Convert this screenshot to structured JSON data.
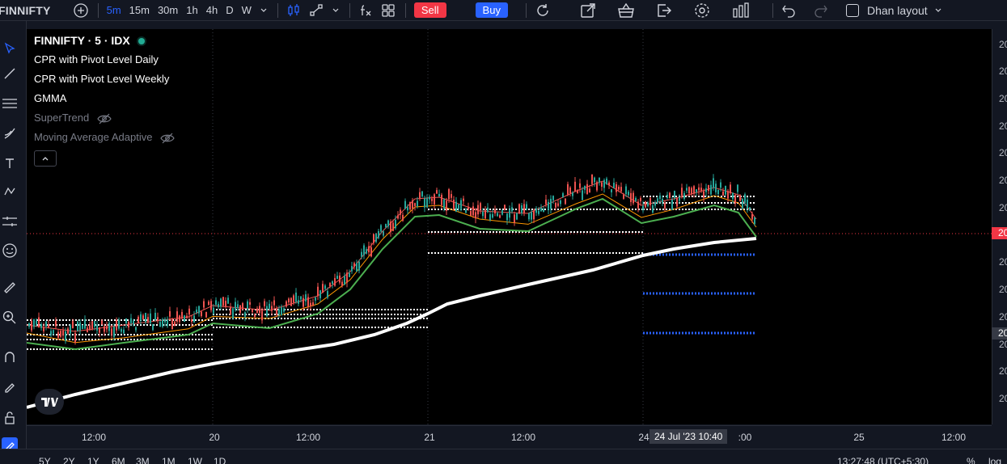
{
  "topbar": {
    "symbol": "FINNIFTY",
    "intervals": [
      "5m",
      "15m",
      "30m",
      "1h",
      "4h",
      "D",
      "W"
    ],
    "active_interval": "5m",
    "sell_label": "Sell",
    "buy_label": "Buy",
    "layout_label": "Dhan layout"
  },
  "legend": {
    "title": "FINNIFTY · 5 · IDX",
    "indicators": [
      {
        "label": "CPR with Pivot Level Daily",
        "hidden": false
      },
      {
        "label": "CPR with Pivot Level Weekly",
        "hidden": false
      },
      {
        "label": "GMMA",
        "hidden": false
      },
      {
        "label": "SuperTrend",
        "hidden": true
      },
      {
        "label": "Moving Average Adaptive",
        "hidden": true
      }
    ]
  },
  "right_axis": {
    "labels": [
      "20",
      "20",
      "20",
      "20",
      "20",
      "20",
      "20",
      "20",
      "20",
      "20",
      "20",
      "20",
      "20",
      "20"
    ],
    "price_badge": "20",
    "cross_badge": "20"
  },
  "time_axis": {
    "labels": [
      {
        "text": "12:00",
        "pos": 0.07
      },
      {
        "text": "20",
        "pos": 0.194
      },
      {
        "text": "12:00",
        "pos": 0.292
      },
      {
        "text": "21",
        "pos": 0.417
      },
      {
        "text": "12:00",
        "pos": 0.514
      },
      {
        "text": "24",
        "pos": 0.64
      },
      {
        "text": ":00",
        "pos": 0.744
      },
      {
        "text": "25",
        "pos": 0.863
      },
      {
        "text": "12:00",
        "pos": 0.962
      }
    ],
    "crosshair_label": "24 Jul '23   10:40"
  },
  "bottombar": {
    "ranges": [
      "5Y",
      "2Y",
      "1Y",
      "6M",
      "3M",
      "1M",
      "1W",
      "1D"
    ],
    "clock": "13:27:48 (UTC+5:30)",
    "percent": "%",
    "log": "log"
  },
  "colors": {
    "up": "#26a69a",
    "down": "#ef5350",
    "gmma_fast": "#ff9800",
    "gmma_slow": "#4caf50",
    "vwap": "#ffffff",
    "pivot_blue": "#2962ff",
    "price_line": "#f23645"
  }
}
